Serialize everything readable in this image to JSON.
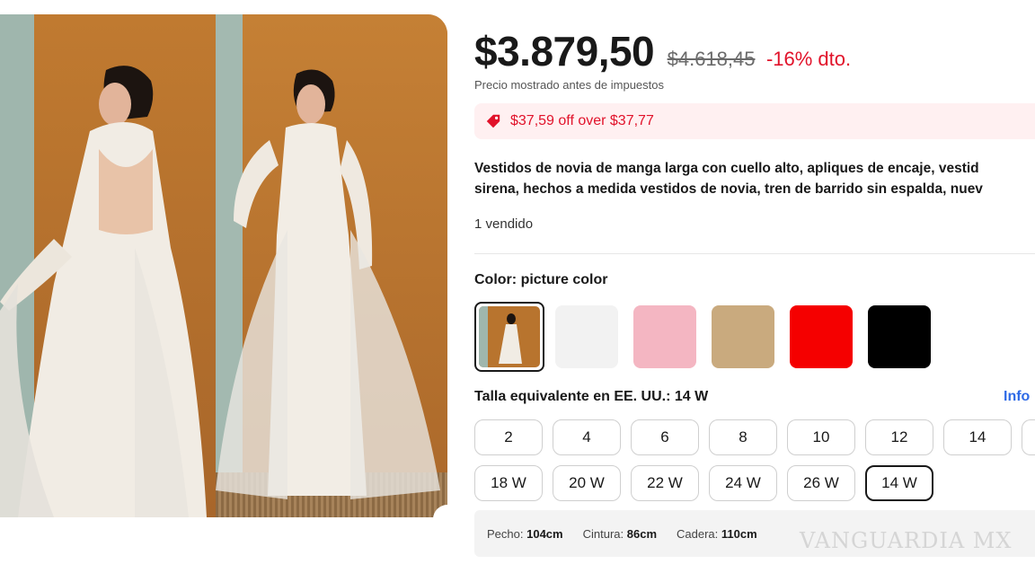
{
  "price": {
    "current": "$3.879,50",
    "original": "$4.618,45",
    "discount": "-16% dto.",
    "tax_note": "Precio mostrado antes de impuestos"
  },
  "promo": {
    "icon": "tag-icon",
    "text": "$37,59 off over $37,77",
    "color": "#e1122a"
  },
  "product": {
    "title_line1": "Vestidos de novia de manga larga con cuello alto, apliques de encaje, vestid",
    "title_line2": "sirena, hechos a medida vestidos de novia, tren de barrido sin espalda, nuev",
    "sold": "1 vendido"
  },
  "color": {
    "label": "Color:",
    "value": "picture color",
    "swatches": [
      {
        "name": "picture color",
        "hex": "#b8742e",
        "selected": true
      },
      {
        "name": "white",
        "hex": "#f2f2f2",
        "selected": false
      },
      {
        "name": "pink",
        "hex": "#f4b6c2",
        "selected": false
      },
      {
        "name": "champagne",
        "hex": "#c9aa7e",
        "selected": false
      },
      {
        "name": "red",
        "hex": "#f50000",
        "selected": false
      },
      {
        "name": "black",
        "hex": "#000000",
        "selected": false
      }
    ]
  },
  "size": {
    "label": "Talla equivalente en EE. UU.: 14 W",
    "info_link": "Info",
    "row1": [
      "2",
      "4",
      "6",
      "8",
      "10",
      "12",
      "14"
    ],
    "row2": [
      "18 W",
      "20 W",
      "22 W",
      "24 W",
      "26 W",
      "14 W"
    ],
    "selected": "14 W"
  },
  "measurements": {
    "chest_label": "Pecho:",
    "chest_value": "104cm",
    "waist_label": "Cintura:",
    "waist_value": "86cm",
    "hip_label": "Cadera:",
    "hip_value": "110cm"
  },
  "watermark": "VANGUARDIA MX"
}
